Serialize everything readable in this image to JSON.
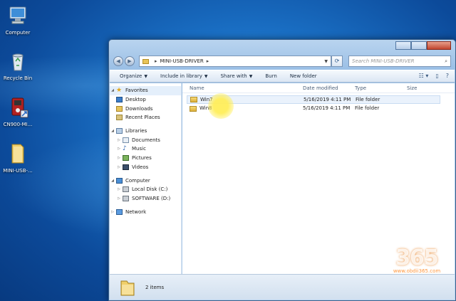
{
  "desktop": {
    "icons": [
      {
        "label": "Computer",
        "icon": "computer-icon"
      },
      {
        "label": "Recycle Bin",
        "icon": "recycle-bin-icon"
      },
      {
        "label": "CN900-MI...",
        "icon": "app-icon"
      },
      {
        "label": "MINI-USB-...",
        "icon": "folder-icon"
      }
    ]
  },
  "window": {
    "address": {
      "path": "MINI-USB-DRIVER",
      "separator": "▸"
    },
    "search_placeholder": "Search MINI-USB-DRIVER",
    "toolbar": {
      "organize": "Organize",
      "include_in_library": "Include in library",
      "share_with": "Share with",
      "burn": "Burn",
      "new_folder": "New folder"
    },
    "nav": {
      "favorites": "Favorites",
      "desktop": "Desktop",
      "downloads": "Downloads",
      "recent_places": "Recent Places",
      "libraries": "Libraries",
      "documents": "Documents",
      "music": "Music",
      "pictures": "Pictures",
      "videos": "Videos",
      "computer": "Computer",
      "local_disk": "Local Disk (C:)",
      "software": "SOFTWARE (D:)",
      "network": "Network"
    },
    "columns": {
      "name": "Name",
      "date_modified": "Date modified",
      "type": "Type",
      "size": "Size"
    },
    "files": [
      {
        "name": "Win7",
        "date": "5/16/2019 4:11 PM",
        "type": "File folder",
        "size": ""
      },
      {
        "name": "Win8",
        "date": "5/16/2019 4:11 PM",
        "type": "File folder",
        "size": ""
      }
    ],
    "status": "2 items"
  },
  "watermark": {
    "number": "365",
    "url": "www.obdii365.com"
  }
}
